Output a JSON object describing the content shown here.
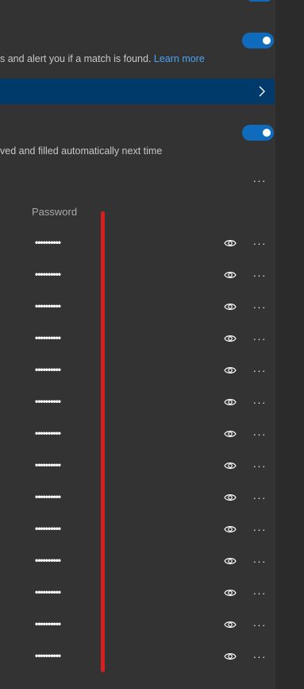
{
  "breach_alert": {
    "text": "s and alert you if a match is found.",
    "link": "Learn more",
    "toggle_on": true
  },
  "autofill": {
    "text": "ved and filled automatically next time",
    "toggle_on": true
  },
  "icons": {
    "chevron": "chevron-right-icon",
    "more": "more-horizontal-icon",
    "eye": "eye-icon"
  },
  "more_glyph": "···",
  "passwords": {
    "column_header": "Password",
    "rows": [
      {
        "masked": "••••••••••"
      },
      {
        "masked": "••••••••••"
      },
      {
        "masked": "••••••••••"
      },
      {
        "masked": "••••••••••"
      },
      {
        "masked": "••••••••••"
      },
      {
        "masked": "••••••••••"
      },
      {
        "masked": "••••••••••"
      },
      {
        "masked": "••••••••••"
      },
      {
        "masked": "••••••••••"
      },
      {
        "masked": "••••••••••"
      },
      {
        "masked": "••••••••••"
      },
      {
        "masked": "••••••••••"
      },
      {
        "masked": "••••••••••"
      },
      {
        "masked": "••••••••••"
      }
    ]
  },
  "colors": {
    "accent": "#0f6cbd",
    "link": "#4ca3f2",
    "annotation": "#d61f1f",
    "nav_bar": "#003a6b"
  }
}
